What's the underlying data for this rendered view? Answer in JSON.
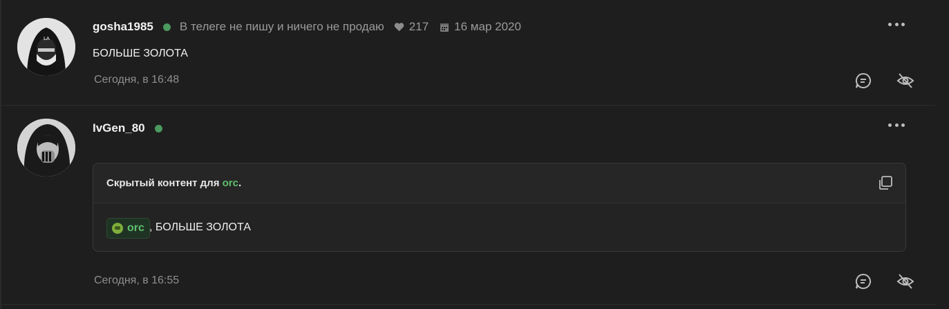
{
  "posts": [
    {
      "username": "gosha1985",
      "status": "В телеге не пишу и ничего не продаю",
      "likes": "217",
      "joined": "16 мар 2020",
      "body": "БОЛЬШЕ ЗОЛОТА",
      "time": "Сегодня, в 16:48"
    },
    {
      "username": "IvGen_80",
      "hidden": {
        "title_prefix": "Скрытый контент для",
        "group": "orc",
        "title_suffix": ".",
        "mention": "orc",
        "text": ", БОЛЬШЕ ЗОЛОТА"
      },
      "time": "Сегодня, в 16:55"
    }
  ],
  "colors": {
    "background": "#1e1e1e",
    "online": "#4c9a5f",
    "group_accent": "#5fbf6e"
  },
  "icons": [
    "heart-icon",
    "calendar-icon",
    "more-icon",
    "reply-icon",
    "hide-icon",
    "copy-icon"
  ]
}
